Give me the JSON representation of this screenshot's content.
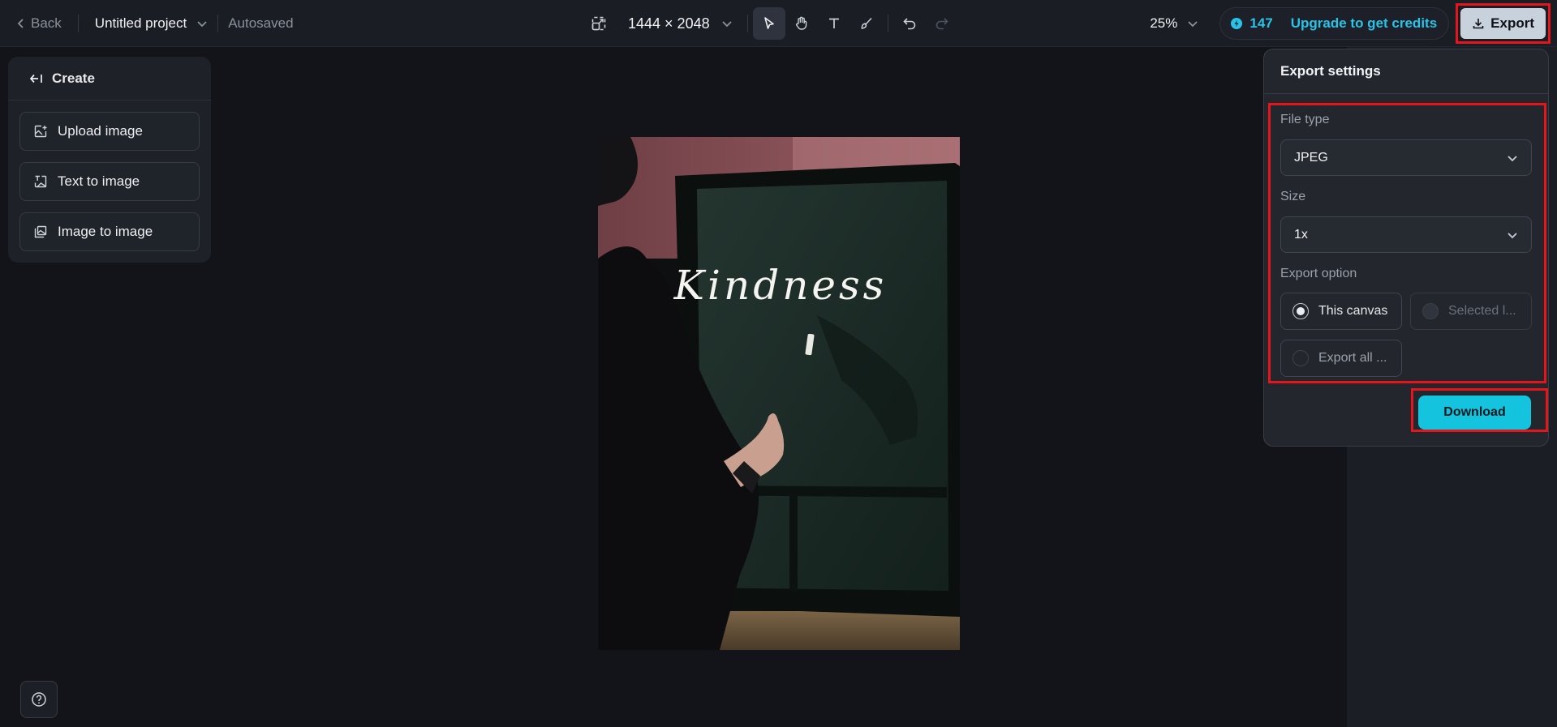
{
  "topbar": {
    "back_label": "Back",
    "project_name": "Untitled project",
    "autosave_status": "Autosaved",
    "canvas_size": "1444 × 2048",
    "zoom": "25%",
    "credits": "147",
    "upgrade_label": "Upgrade to get credits",
    "export_label": "Export",
    "tools": [
      "select-tool",
      "hand-tool",
      "text-tool",
      "brush-tool",
      "undo",
      "redo"
    ]
  },
  "create_panel": {
    "title": "Create",
    "items": [
      {
        "label": "Upload image",
        "icon": "upload-image-icon"
      },
      {
        "label": "Text to image",
        "icon": "text-to-image-icon"
      },
      {
        "label": "Image to image",
        "icon": "image-to-image-icon"
      }
    ]
  },
  "canvas": {
    "image_text": "Kindness"
  },
  "export_panel": {
    "title": "Export settings",
    "file_type_label": "File type",
    "file_type_value": "JPEG",
    "size_label": "Size",
    "size_value": "1x",
    "export_option_label": "Export option",
    "options": [
      {
        "label": "This canvas",
        "selected": true,
        "state": "enabled"
      },
      {
        "label": "Selected l...",
        "selected": false,
        "state": "disabled"
      },
      {
        "label": "Export all ...",
        "selected": false,
        "state": "enabled"
      }
    ],
    "download_label": "Download"
  },
  "colors": {
    "accent": "#14c3dd",
    "highlight": "#e5151c",
    "background": "#121419"
  }
}
